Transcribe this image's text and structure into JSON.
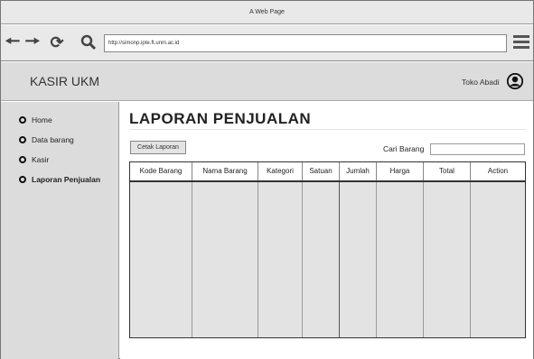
{
  "window": {
    "title": "A Web Page"
  },
  "browser": {
    "url": "http://simonp.ipte.ft.unm.ac.id"
  },
  "header": {
    "app_title": "KASIR UKM",
    "user_name": "Toko Abadi"
  },
  "sidebar": {
    "items": [
      {
        "label": "Home"
      },
      {
        "label": "Data barang"
      },
      {
        "label": "Kasir"
      },
      {
        "label": "Laporan Penjualan"
      }
    ]
  },
  "main": {
    "title": "LAPORAN PENJUALAN",
    "print_button": "Cetak Laporan",
    "search_label": "Cari Barang",
    "search_value": "",
    "table": {
      "columns": [
        "Kode Barang",
        "Nama Barang",
        "Kategori",
        "Satuan",
        "Jumlah",
        "Harga",
        "Total",
        "Action"
      ]
    }
  },
  "icons": {
    "back": "arrow-left-icon",
    "forward": "arrow-right-icon",
    "reload": "reload-icon",
    "search": "search-icon",
    "menu": "hamburger-menu-icon",
    "user": "user-avatar-icon",
    "nav": "radio-circle-icon"
  }
}
